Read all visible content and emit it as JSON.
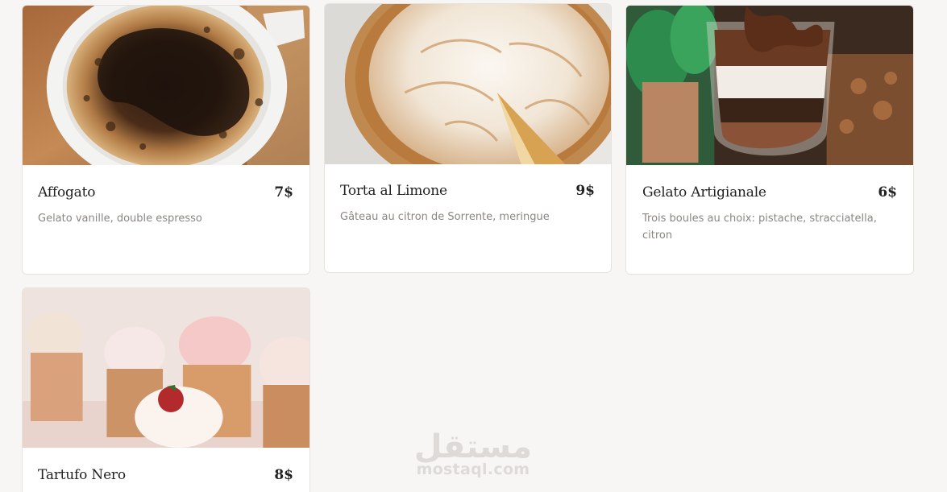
{
  "menu": {
    "items": [
      {
        "title": "Affogato",
        "price": "7$",
        "description": "Gelato vanille, double espresso",
        "image": "espresso-cup-photo"
      },
      {
        "title": "Torta al Limone",
        "price": "9$",
        "description": "Gâteau au citron de Sorrente, meringue",
        "image": "lemon-meringue-pie-photo"
      },
      {
        "title": "Gelato Artigianale",
        "price": "6$",
        "description": "Trois boules au choix: pistache, stracciatella, citron",
        "image": "gelato-glass-photo"
      },
      {
        "title": "Tartufo Nero",
        "price": "8$",
        "description": "",
        "image": "cupcakes-photo"
      }
    ]
  },
  "watermark": {
    "arabic": "مستقل",
    "domain": "mostaql.com"
  },
  "colors": {
    "page_background": "#f7f6f4",
    "card_background": "#ffffff",
    "title_text": "#222222",
    "description_text": "#8b8682"
  }
}
